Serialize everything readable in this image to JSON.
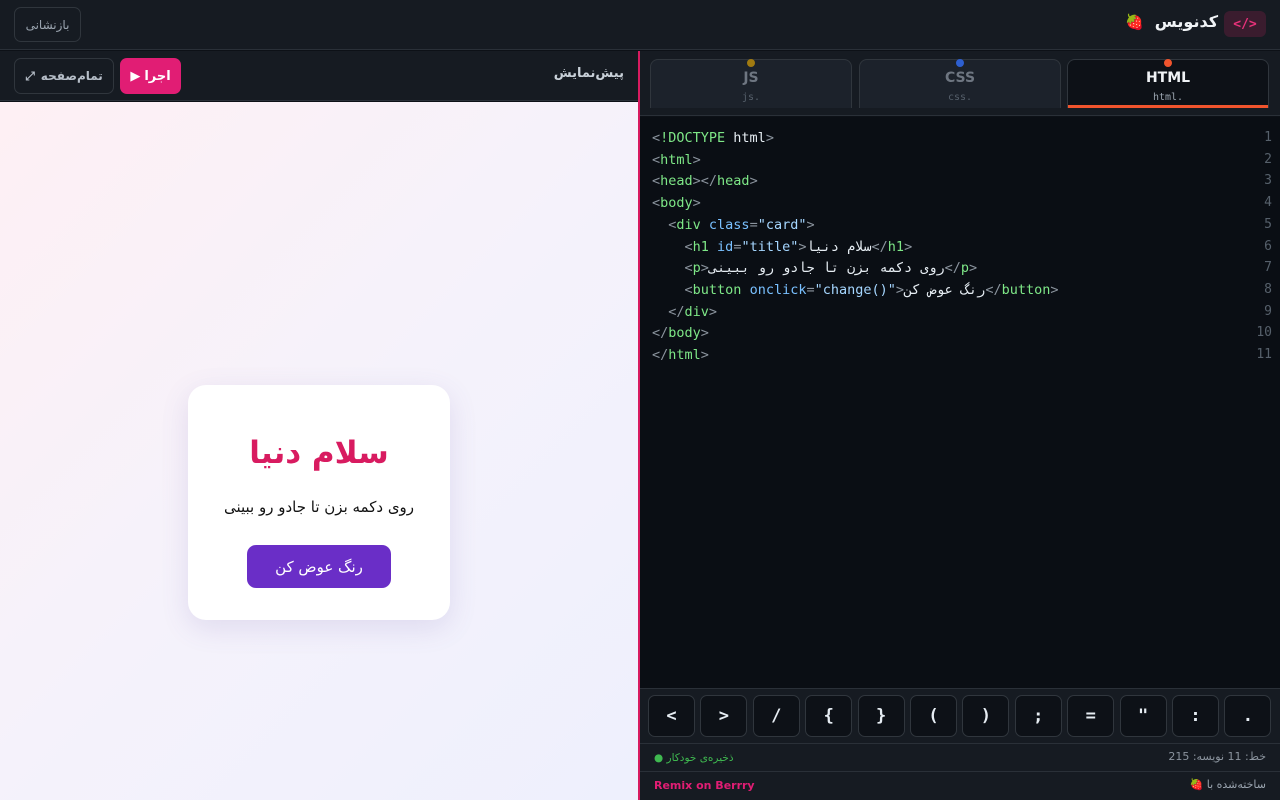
{
  "app": {
    "title": "کدنویس",
    "logo_glyph": "</>",
    "berry_icon": "🍓",
    "reset_label": "بازنشانی"
  },
  "preview": {
    "label": "پیش‌نمایش",
    "run_label": "اجرا",
    "run_icon": "▶",
    "fullscreen_label": "تمام‌صفحه",
    "fullscreen_icon": "⤢",
    "card": {
      "title": "سلام دنیا",
      "text": "روی دکمه بزن تا جادو رو ببینی",
      "button": "رنگ عوض کن"
    }
  },
  "editor": {
    "tabs": [
      {
        "name": "HTML",
        "ext": "html.",
        "dot_color": "#f0542d",
        "active": true
      },
      {
        "name": "CSS",
        "ext": "css.",
        "dot_color": "#2d5fd0",
        "active": false
      },
      {
        "name": "JS",
        "ext": "js.",
        "dot_color": "#a07a10",
        "active": false
      }
    ],
    "lines": [
      {
        "n": "1",
        "tokens": [
          [
            "p",
            "<"
          ],
          [
            "t",
            "!DOCTYPE"
          ],
          [
            "x",
            " html"
          ],
          [
            "p",
            ">"
          ]
        ]
      },
      {
        "n": "2",
        "tokens": [
          [
            "p",
            "<"
          ],
          [
            "t",
            "html"
          ],
          [
            "p",
            ">"
          ]
        ]
      },
      {
        "n": "3",
        "tokens": [
          [
            "p",
            "<"
          ],
          [
            "t",
            "head"
          ],
          [
            "p",
            "></"
          ],
          [
            "t",
            "head"
          ],
          [
            "p",
            ">"
          ]
        ]
      },
      {
        "n": "4",
        "tokens": [
          [
            "p",
            "<"
          ],
          [
            "t",
            "body"
          ],
          [
            "p",
            ">"
          ]
        ]
      },
      {
        "n": "5",
        "tokens": [
          [
            "x",
            "  "
          ],
          [
            "p",
            "<"
          ],
          [
            "t",
            "div"
          ],
          [
            "a",
            " class"
          ],
          [
            "p",
            "="
          ],
          [
            "s",
            "\"card\""
          ],
          [
            "p",
            ">"
          ]
        ]
      },
      {
        "n": "6",
        "tokens": [
          [
            "x",
            "    "
          ],
          [
            "p",
            "<"
          ],
          [
            "t",
            "h1"
          ],
          [
            "a",
            " id"
          ],
          [
            "p",
            "="
          ],
          [
            "s",
            "\"title\""
          ],
          [
            "p",
            ">"
          ],
          [
            "x",
            "سلام دنیا"
          ],
          [
            "p",
            "</"
          ],
          [
            "t",
            "h1"
          ],
          [
            "p",
            ">"
          ]
        ]
      },
      {
        "n": "7",
        "tokens": [
          [
            "x",
            "    "
          ],
          [
            "p",
            "<"
          ],
          [
            "t",
            "p"
          ],
          [
            "p",
            ">"
          ],
          [
            "x",
            "روی دکمه بزن تا جادو رو ببینی"
          ],
          [
            "p",
            "</"
          ],
          [
            "t",
            "p"
          ],
          [
            "p",
            ">"
          ]
        ]
      },
      {
        "n": "8",
        "tokens": [
          [
            "x",
            "    "
          ],
          [
            "p",
            "<"
          ],
          [
            "t",
            "button"
          ],
          [
            "a",
            " onclick"
          ],
          [
            "p",
            "="
          ],
          [
            "s",
            "\"change()\""
          ],
          [
            "p",
            ">"
          ],
          [
            "x",
            "رنگ عوض کن"
          ],
          [
            "p",
            "</"
          ],
          [
            "t",
            "button"
          ],
          [
            "p",
            ">"
          ]
        ]
      },
      {
        "n": "9",
        "tokens": [
          [
            "x",
            "  "
          ],
          [
            "p",
            "</"
          ],
          [
            "t",
            "div"
          ],
          [
            "p",
            ">"
          ]
        ]
      },
      {
        "n": "10",
        "tokens": [
          [
            "p",
            "</"
          ],
          [
            "t",
            "body"
          ],
          [
            "p",
            ">"
          ]
        ]
      },
      {
        "n": "11",
        "tokens": [
          [
            "p",
            "</"
          ],
          [
            "t",
            "html"
          ],
          [
            "p",
            ">"
          ]
        ]
      }
    ],
    "keys": [
      "<",
      ">",
      "/",
      "{",
      "}",
      "(",
      ")",
      ";",
      "=",
      "\"",
      ":",
      "."
    ],
    "status": {
      "autosave": "● ذخیره‌ی خودکار",
      "line_info": "خط: 11    نویسه: 215"
    },
    "footer": {
      "remix": "Remix on Berrry",
      "made_with": "ساخته‌شده با 🍓"
    }
  }
}
